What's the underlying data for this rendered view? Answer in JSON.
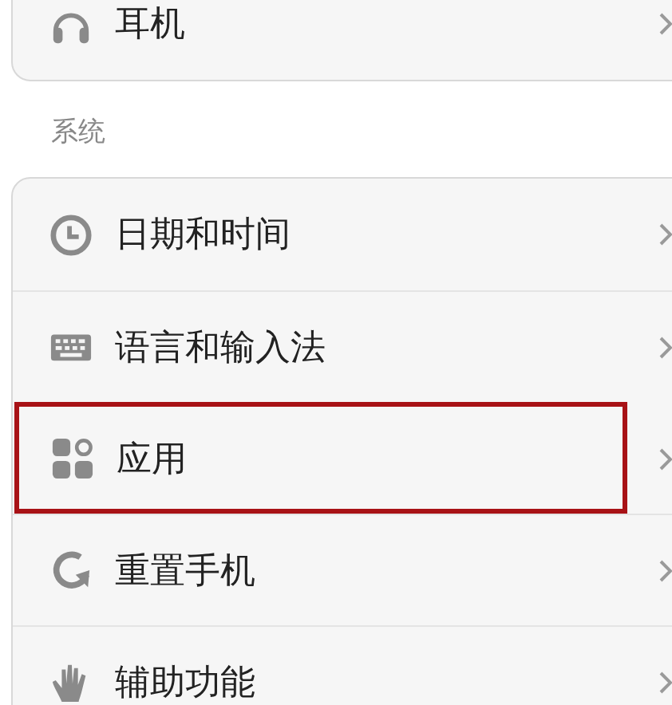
{
  "groups": [
    {
      "items": [
        {
          "kind": "headphones",
          "label": "耳机",
          "highlighted": false
        }
      ]
    },
    {
      "title": "系统",
      "items": [
        {
          "kind": "clock",
          "label": "日期和时间",
          "highlighted": false
        },
        {
          "kind": "keyboard",
          "label": "语言和输入法",
          "highlighted": false
        },
        {
          "kind": "apps",
          "label": "应用",
          "highlighted": true
        },
        {
          "kind": "reset",
          "label": "重置手机",
          "highlighted": false
        },
        {
          "kind": "hand",
          "label": "辅助功能",
          "highlighted": false
        }
      ]
    }
  ]
}
